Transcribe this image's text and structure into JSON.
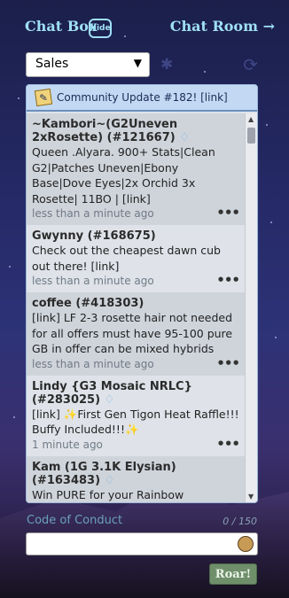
{
  "header": {
    "title": "Chat Box",
    "hide_label": "Hide",
    "chatroom_label": "Chat Room →"
  },
  "controls": {
    "room_select_value": "Sales",
    "select_arrow": "▼",
    "settings_icon": "gear-icon",
    "refresh_icon": "refresh-icon"
  },
  "announcement": {
    "text": "Community Update #182! [link]"
  },
  "messages": [
    {
      "author": "~Kambori~(G2Uneven 2xRosette) (#121667)",
      "text": "Queen .Alyara. 900+ Stats|Clean G2|Patches Uneven|Ebony Base|Dove Eyes|2x Orchid 3x Rosette| 11BO | [link]",
      "time": "less than a minute ago"
    },
    {
      "author": "Gwynny (#168675)",
      "text": "Check out the cheapest dawn cub out there! [link]",
      "time": "less than a minute ago"
    },
    {
      "author": "coffee (#418303)",
      "text": "[link] LF 2-3 rosette hair not needed for all offers must have 95-100 pure GB in offer can be mixed hybrids",
      "time": "less than a minute ago"
    },
    {
      "author": "Lindy {G3 Mosaic NRLC} (#283025)",
      "text": "[link] ✨First Gen Tigon Heat Raffle!!! Buffy Included!!!✨",
      "time": "1 minute ago"
    },
    {
      "author": "Kam (1G 3.1K Elysian) (#163483)",
      "text": "Win PURE for your Rainbow",
      "time": ""
    }
  ],
  "message_menu_label": "•••",
  "badge_glyph": "♢",
  "footer": {
    "code_of_conduct": "Code of Conduct",
    "char_counter": "0 / 150",
    "input_placeholder": "",
    "submit_label": "Roar!"
  }
}
